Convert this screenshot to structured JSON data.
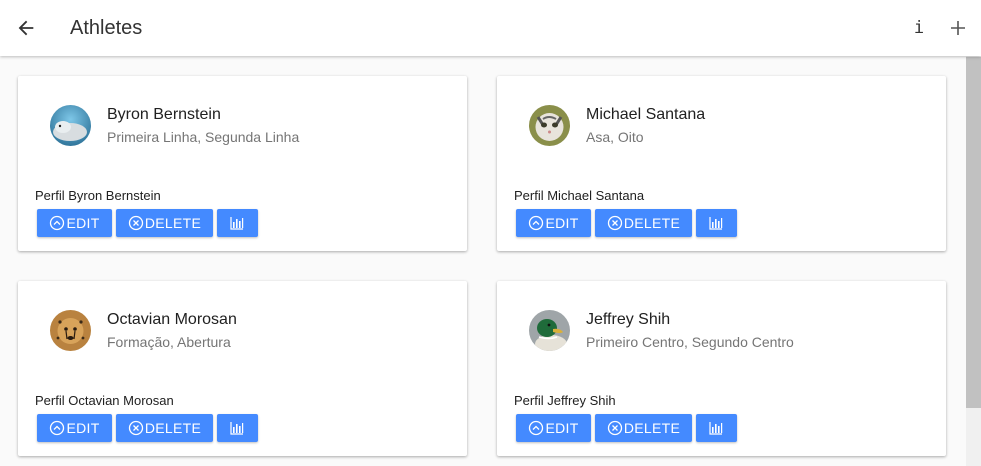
{
  "appbar": {
    "title": "Athletes",
    "info_label": "i"
  },
  "athletes": [
    {
      "name": "Byron Bernstein",
      "positions": "Primeira Linha, Segunda Linha",
      "profile": "Perfil Byron Bernstein",
      "avatar": "seal-photo-icon",
      "edit_label": "EDIT",
      "delete_label": "DELETE"
    },
    {
      "name": "Michael Santana",
      "positions": "Asa, Oito",
      "profile": "Perfil Michael Santana",
      "avatar": "cat-photo-icon",
      "edit_label": "EDIT",
      "delete_label": "DELETE"
    },
    {
      "name": "Octavian Morosan",
      "positions": "Formação, Abertura",
      "profile": "Perfil Octavian Morosan",
      "avatar": "cheetah-photo-icon",
      "edit_label": "EDIT",
      "delete_label": "DELETE"
    },
    {
      "name": "Jeffrey Shih",
      "positions": "Primeiro Centro, Segundo Centro",
      "profile": "Perfil Jeffrey Shih",
      "avatar": "duck-photo-icon",
      "edit_label": "EDIT",
      "delete_label": "DELETE"
    }
  ],
  "colors": {
    "button": "#448aff",
    "appbar_bg": "#ffffff",
    "page_bg": "#fafafa"
  }
}
